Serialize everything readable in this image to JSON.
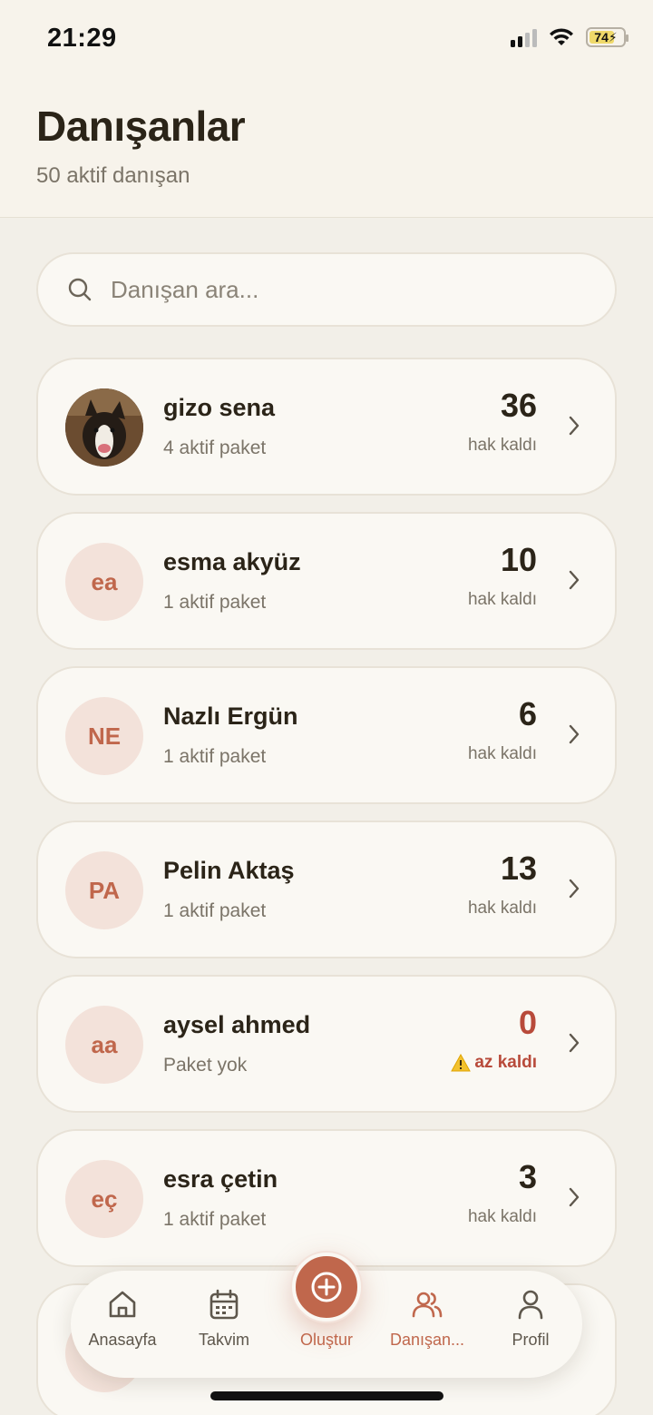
{
  "status_bar": {
    "time": "21:29",
    "battery": "74"
  },
  "header": {
    "title": "Danışanlar",
    "subtitle": "50 aktif danışan"
  },
  "search": {
    "placeholder": "Danışan ara..."
  },
  "clients": [
    {
      "initials": "",
      "has_photo": true,
      "name": "gizo sena",
      "sub": "4 aktif paket",
      "count": "36",
      "count_label": "hak kaldı"
    },
    {
      "initials": "ea",
      "name": "esma akyüz",
      "sub": "1 aktif paket",
      "count": "10",
      "count_label": "hak kaldı"
    },
    {
      "initials": "NE",
      "name": "Nazlı Ergün",
      "sub": "1 aktif paket",
      "count": "6",
      "count_label": "hak kaldı"
    },
    {
      "initials": "PA",
      "name": "Pelin Aktaş",
      "sub": "1 aktif paket",
      "count": "13",
      "count_label": "hak kaldı"
    },
    {
      "initials": "aa",
      "name": "aysel ahmed",
      "sub": "Paket yok",
      "count": "0",
      "count_label": "az kaldı",
      "warning": true
    },
    {
      "initials": "eç",
      "name": "esra çetin",
      "sub": "1 aktif paket",
      "count": "3",
      "count_label": "hak kaldı"
    }
  ],
  "tabbar": {
    "home": "Anasayfa",
    "calendar": "Takvim",
    "create": "Oluştur",
    "clients": "Danışan...",
    "profile": "Profil"
  },
  "colors": {
    "accent": "#c0674c",
    "danger": "#b84a3a",
    "background": "#f2efe8"
  }
}
